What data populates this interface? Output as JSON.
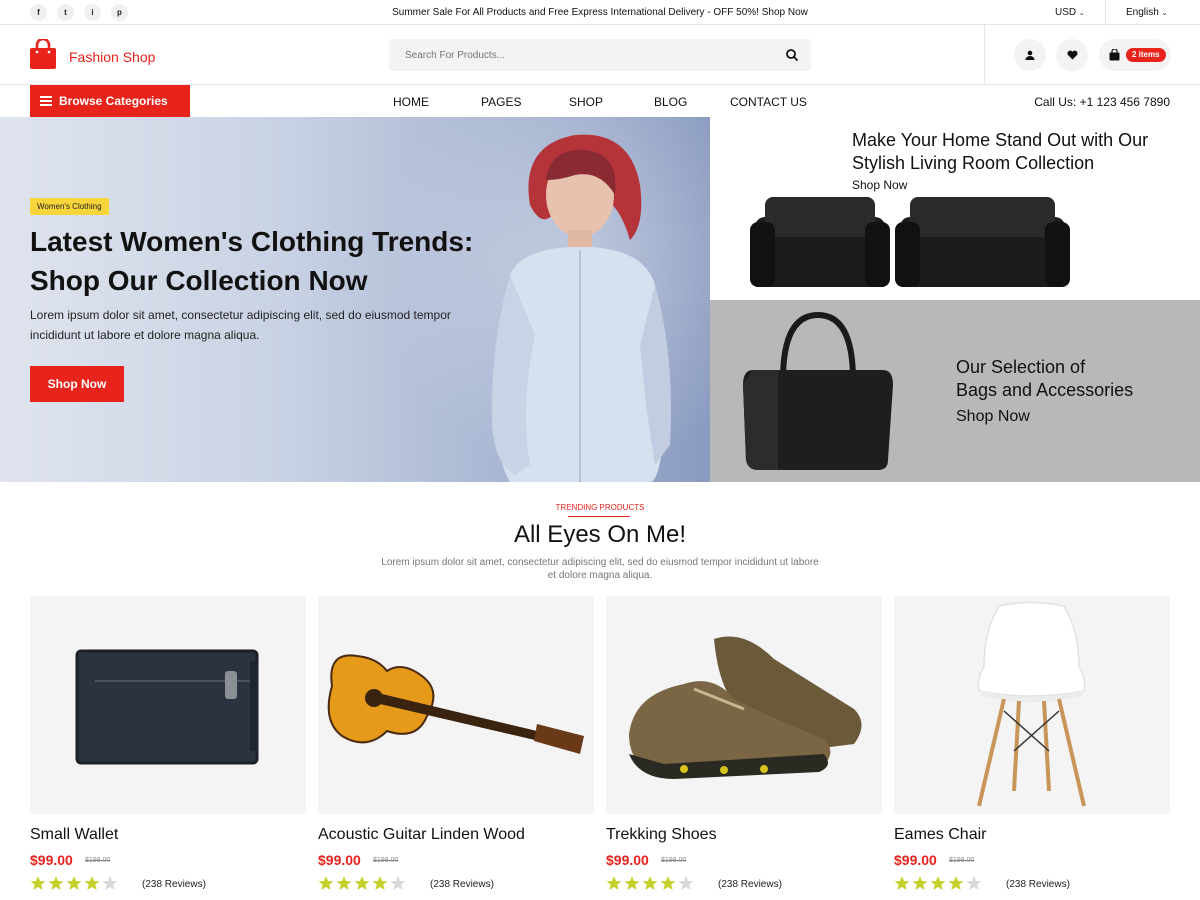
{
  "topbar": {
    "social": [
      "f",
      "t",
      "i",
      "p"
    ],
    "promo": "Summer Sale For All Products and Free Express International Delivery - OFF 50%! Shop Now",
    "currency": "USD",
    "language": "English"
  },
  "header": {
    "logo_text": "Fashion Shop",
    "search_placeholder": "Search For Products...",
    "cart_badge": "2 items"
  },
  "nav": {
    "browse": "Browse Categories",
    "links": [
      "HOME",
      "PAGES",
      "SHOP",
      "BLOG",
      "CONTACT US"
    ],
    "callus": "Call Us: +1 123 456 7890"
  },
  "hero": {
    "tag": "Women's Clothing",
    "title": "Latest Women's Clothing Trends: Shop Our Collection Now",
    "desc": "Lorem ipsum dolor sit amet, consectetur adipiscing elit, sed do eiusmod tempor incididunt ut labore et dolore magna aliqua.",
    "button": "Shop Now"
  },
  "banner1": {
    "title": "Make Your Home Stand Out with Our Stylish Living Room Collection",
    "link": "Shop Now"
  },
  "banner2": {
    "title_line1": "Our Selection of",
    "title_line2": "Bags and Accessories",
    "link": "Shop Now"
  },
  "section": {
    "tag": "TRENDING PRODUCTS",
    "title": "All Eyes On Me!",
    "desc": "Lorem ipsum dolor sit amet, consectetur adipiscing elit, sed do eiusmod tempor incididunt ut labore et dolore magna aliqua."
  },
  "products": [
    {
      "name": "Small Wallet",
      "price": "$99.00",
      "old_price": "$199.00",
      "rating": 4,
      "reviews": "(238 Reviews)"
    },
    {
      "name": "Acoustic Guitar Linden Wood",
      "price": "$99.00",
      "old_price": "$199.00",
      "rating": 4,
      "reviews": "(238 Reviews)"
    },
    {
      "name": "Trekking Shoes",
      "price": "$99.00",
      "old_price": "$199.00",
      "rating": 4,
      "reviews": "(238 Reviews)"
    },
    {
      "name": "Eames Chair",
      "price": "$99.00",
      "old_price": "$199.00",
      "rating": 4,
      "reviews": "(238 Reviews)"
    }
  ],
  "colors": {
    "accent": "#e8231c",
    "tag_yellow": "#f8d53a",
    "star": "#c5d12b"
  }
}
